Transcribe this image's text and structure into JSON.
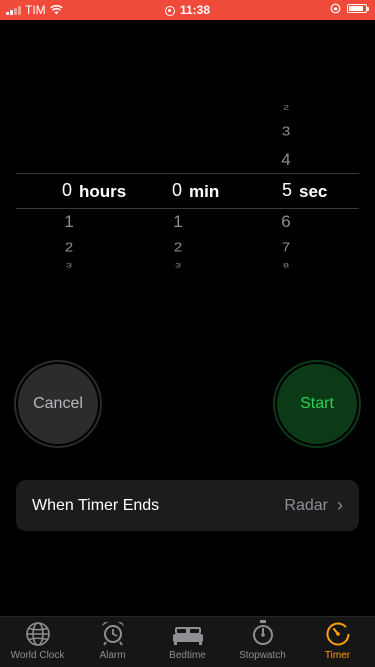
{
  "status_bar": {
    "carrier": "TIM",
    "time": "11:38"
  },
  "picker": {
    "hours": {
      "selected": "0",
      "unit": "hours",
      "below": [
        "1",
        "2",
        "3"
      ]
    },
    "minutes": {
      "selected": "0",
      "unit": "min",
      "below": [
        "1",
        "2",
        "3"
      ]
    },
    "seconds": {
      "above": [
        "2",
        "3",
        "4"
      ],
      "selected": "5",
      "unit": "sec",
      "below": [
        "6",
        "7",
        "8"
      ]
    }
  },
  "buttons": {
    "cancel": "Cancel",
    "start": "Start"
  },
  "when_timer_ends": {
    "label": "When Timer Ends",
    "value": "Radar"
  },
  "tabs": [
    {
      "label": "World Clock",
      "icon": "globe-icon"
    },
    {
      "label": "Alarm",
      "icon": "alarm-clock-icon"
    },
    {
      "label": "Bedtime",
      "icon": "bed-icon"
    },
    {
      "label": "Stopwatch",
      "icon": "stopwatch-icon"
    },
    {
      "label": "Timer",
      "icon": "timer-icon",
      "active": true
    }
  ],
  "colors": {
    "status_bar": "#ef4a3a",
    "accent": "#ff9f0a",
    "start_green": "#2ed158"
  }
}
